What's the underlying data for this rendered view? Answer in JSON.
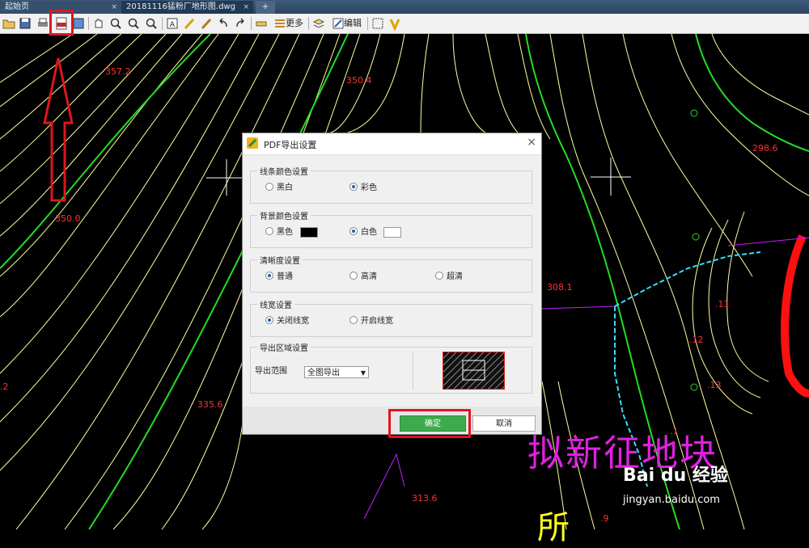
{
  "tabs": [
    {
      "label": "起始页",
      "close": "×"
    },
    {
      "label": "20181116猛粉厂地形图.dwg",
      "close": "×"
    },
    {
      "label": "+"
    }
  ],
  "toolbar": {
    "more_label": "更多",
    "edit_label": "编辑"
  },
  "drawing": {
    "elevations": [
      "357.2",
      "350.4",
      "298.6",
      "350.0",
      "308.1",
      "335.6",
      "313.6"
    ],
    "small_labels": [
      ".11",
      ".12",
      ".13",
      ".2",
      ".1",
      ".9"
    ],
    "annotation": "拟新征地块",
    "partial_text": "所"
  },
  "dialog": {
    "title": "PDF导出设置",
    "close": "×",
    "line_color": {
      "label": "线条颜色设置",
      "options": [
        "黑白",
        "彩色"
      ],
      "selected": "彩色"
    },
    "bg_color": {
      "label": "背景颜色设置",
      "options": [
        "黑色",
        "白色"
      ],
      "selected": "白色"
    },
    "clarity": {
      "label": "清晰度设置",
      "options": [
        "普通",
        "高清",
        "超清"
      ],
      "selected": "普通"
    },
    "line_width": {
      "label": "线宽设置",
      "options": [
        "关闭线宽",
        "开启线宽"
      ],
      "selected": "关闭线宽"
    },
    "export_area": {
      "label": "导出区域设置",
      "range_label": "导出范围",
      "range_value": "全图导出"
    },
    "ok_label": "确定",
    "cancel_label": "取消"
  },
  "watermark": {
    "brand": "Bai du 经验",
    "url": "jingyan.baidu.com"
  },
  "colors": {
    "contour": "#ffffa0",
    "index_contour": "#22dd22",
    "elevation_text": "#ff3030",
    "highlight": "#e0151d",
    "ok_button": "#3eaa4e"
  }
}
